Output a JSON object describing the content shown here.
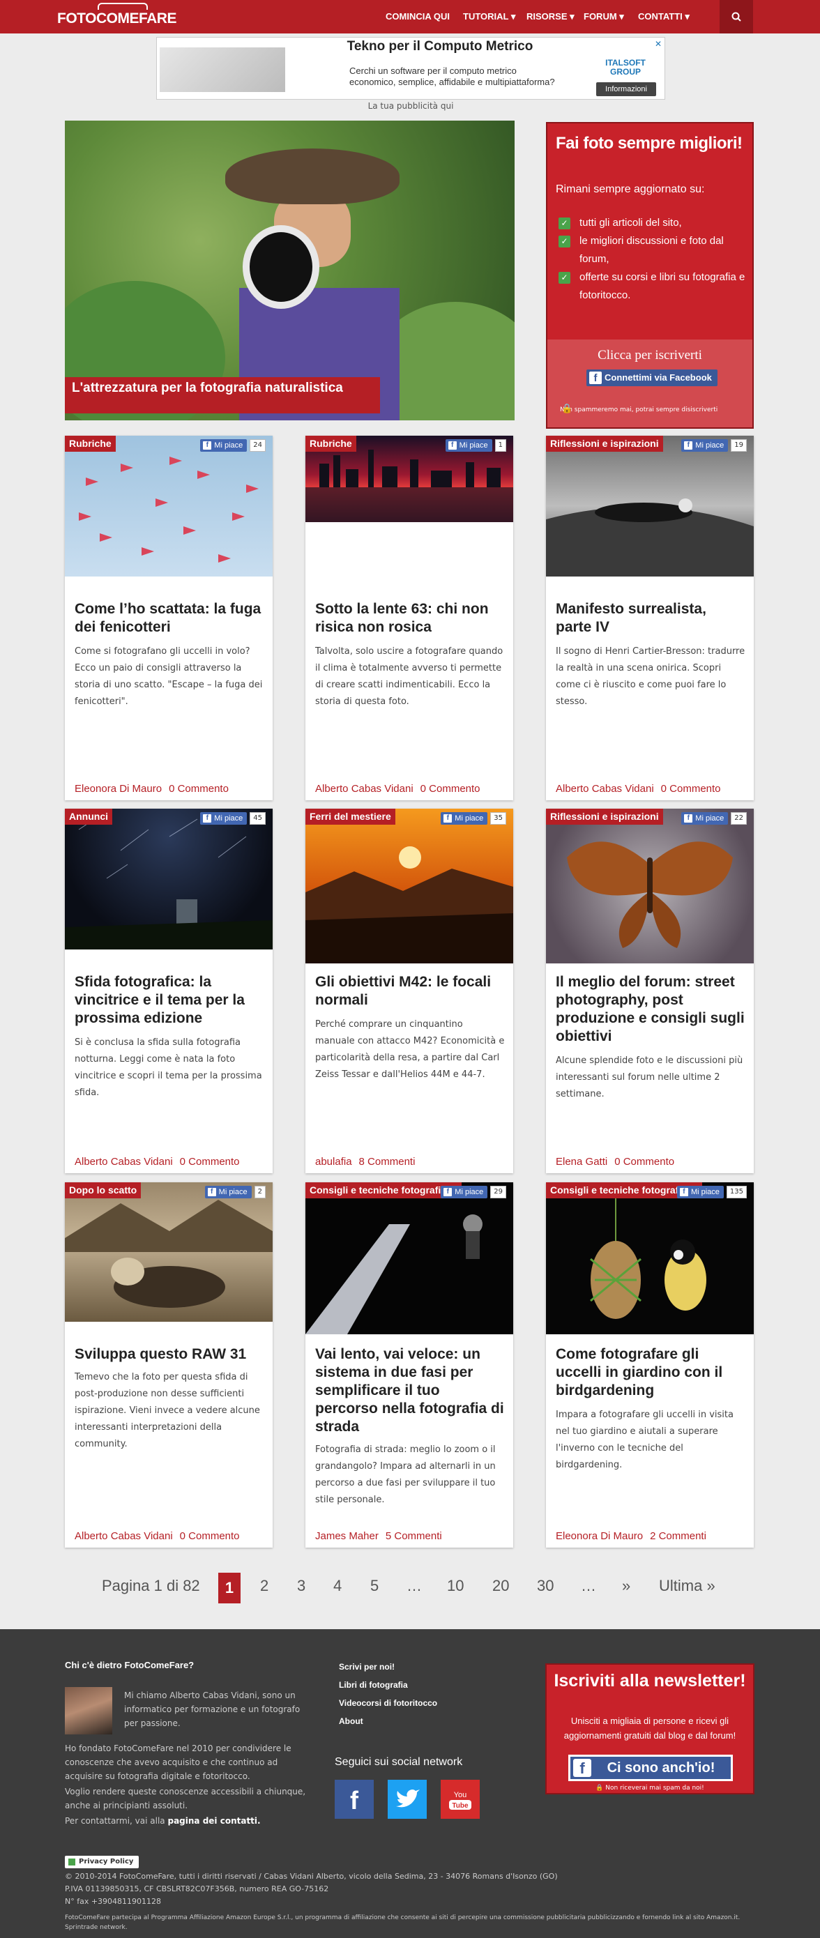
{
  "brand": {
    "logo": "FOTOCOMEFARE",
    "accent": "#b51f25"
  },
  "nav": {
    "items": [
      "COMINCIA QUI",
      "TUTORIAL ▾",
      "RISORSE ▾",
      "FORUM ▾",
      "CONTATTI ▾"
    ]
  },
  "ad": {
    "title": "Tekno per il Computo Metrico",
    "text": "Cerchi un software per il computo metrico economico, semplice, affidabile e multipiattaforma?",
    "brand": "ITALSOFT GROUP",
    "info": "Informazioni",
    "close": "✕",
    "note": "La tua pubblicità qui"
  },
  "hero": {
    "caption": "L'attrezzatura per la fotografia naturalistica"
  },
  "signup": {
    "title": "Fai foto sempre migliori!",
    "subtitle": "Rimani sempre aggiornato su:",
    "bullets": [
      "tutti gli articoli del sito,",
      "le migliori discussioni e foto dal forum,",
      "offerte su corsi e libri su fotografia e fotoritocco."
    ],
    "cta": "Clicca per iscriverti",
    "fb_button": "Connettimi via Facebook",
    "note": "Non spammeremo mai, potrai sempre disiscriverti"
  },
  "like_label": "Mi piace",
  "cards": [
    {
      "category": "Rubriche",
      "likes": "24",
      "title": "Come l’ho scattata: la fuga dei fenicotteri",
      "excerpt": "Come si fotografano gli uccelli in volo? Ecco un paio di consigli attraverso la storia di uno scatto. \"Escape – la fuga dei fenicotteri\".",
      "author": "Eleonora Di Mauro",
      "comments": "0 Commento"
    },
    {
      "category": "Rubriche",
      "likes": "1",
      "title": "Sotto la lente 63: chi non risica non rosica",
      "excerpt": "Talvolta, solo uscire a fotografare quando il clima è totalmente avverso ti permette di creare scatti indimenticabili. Ecco la storia di questa foto.",
      "author": "Alberto Cabas Vidani",
      "comments": "0 Commento"
    },
    {
      "category": "Riflessioni e ispirazioni",
      "likes": "19",
      "title": "Manifesto surrealista, parte IV",
      "excerpt": "Il sogno di Henri Cartier-Bresson: tradurre la realtà in una scena onirica. Scopri come ci è riuscito e come puoi fare lo stesso.",
      "author": "Alberto Cabas Vidani",
      "comments": "0 Commento"
    },
    {
      "category": "Annunci",
      "likes": "45",
      "title": "Sfida fotografica: la vincitrice e il tema per la prossima edizione",
      "excerpt": "Si è conclusa la sfida sulla fotografia notturna. Leggi come è nata la foto vincitrice e scopri il tema per la prossima sfida.",
      "author": "Alberto Cabas Vidani",
      "comments": "0 Commento"
    },
    {
      "category": "Ferri del mestiere",
      "likes": "35",
      "title": "Gli obiettivi M42: le focali normali",
      "excerpt": "Perché comprare un cinquantino manuale con attacco M42? Economicità e particolarità della resa, a partire dal Carl Zeiss Tessar e dall'Helios 44M e 44-7.",
      "author": "abulafia",
      "comments": "8 Commenti"
    },
    {
      "category": "Riflessioni e ispirazioni",
      "likes": "22",
      "title": "Il meglio del forum: street photography, post produzione e consigli sugli obiettivi",
      "excerpt": "Alcune splendide foto e le discussioni più interessanti sul forum nelle ultime 2 settimane.",
      "author": "Elena Gatti",
      "comments": "0 Commento"
    },
    {
      "category": "Dopo lo scatto",
      "likes": "2",
      "title": "Sviluppa questo RAW 31",
      "excerpt": "Temevo che la foto per questa sfida di post-produzione non desse sufficienti ispirazione. Vieni invece a vedere alcune interessanti interpretazioni della community.",
      "author": "Alberto Cabas Vidani",
      "comments": "0 Commento"
    },
    {
      "category": "Consigli e tecniche fotografiche",
      "likes": "29",
      "title": "Vai lento, vai veloce: un sistema in due fasi per semplificare il tuo percorso nella fotografia di strada",
      "excerpt": "Fotografia di strada: meglio lo zoom o il grandangolo? Impara ad alternarli in un percorso a due fasi per sviluppare il tuo stile personale.",
      "author": "James Maher",
      "comments": "5 Commenti"
    },
    {
      "category": "Consigli e tecniche fotografiche",
      "likes": "135",
      "title": "Come fotografare gli uccelli in giardino con il birdgardening",
      "excerpt": "Impara a fotografare gli uccelli in visita nel tuo giardino e aiutali a superare l'inverno con le tecniche del birdgardening.",
      "author": "Eleonora Di Mauro",
      "comments": "2 Commenti"
    }
  ],
  "pager": {
    "summary": "Pagina 1 di 82",
    "current": "1",
    "pages": [
      "2",
      "3",
      "4",
      "5",
      "…",
      "10",
      "20",
      "30",
      "…",
      "»",
      "Ultima »"
    ]
  },
  "footer": {
    "who_title": "Chi c'è dietro FotoComeFare?",
    "bio": "Mi chiamo Alberto Cabas Vidani, sono un informatico per formazione e un fotografo per passione.",
    "p1": "Ho fondato FotoComeFare nel 2010 per condividere le conoscenze che avevo acquisito e che continuo ad acquisire su fotografia digitale e fotoritocco.",
    "p2": "Voglio rendere queste conoscenze accessibili a chiunque, anche ai principianti assoluti.",
    "contact_prefix": "Per contattarmi, vai alla ",
    "contact_link": "pagina dei contatti.",
    "links": [
      "Scrivi per noi!",
      "Libri di fotografia",
      "Videocorsi di fotoritocco",
      "About"
    ],
    "social_title": "Seguici sui social network",
    "social": [
      {
        "name": "facebook",
        "glyph": "f",
        "color": "#3b5998"
      },
      {
        "name": "twitter",
        "glyph": "t",
        "color": "#1da1f2"
      },
      {
        "name": "youtube",
        "glyph": "You Tube",
        "color": "#d62b2b"
      }
    ],
    "news_title": "Iscriviti alla newsletter!",
    "news_text": "Unisciti a migliaia di persone e ricevi gli aggiornamenti gratuiti dal blog e dal forum!",
    "news_button": "Ci sono anch'io!",
    "news_note": "Non riceverai mai spam da noi!",
    "privacy": "Privacy Policy",
    "copy1": "© 2010-2014 FotoComeFare, tutti i diritti riservati / Cabas Vidani Alberto, vicolo della Sedima, 23 - 34076 Romans d'Isonzo (GO)",
    "copy2": "P.IVA 01139850315, CF CBSLRT82C07F356B, numero REA GO-75162",
    "copy3": "N° fax +3904811901128",
    "amazon": "FotoComeFare partecipa al Programma Affiliazione Amazon Europe S.r.l., un programma di affiliazione che consente ai siti di percepire una commissione pubblicitaria pubblicizzando e fornendo link al sito Amazon.it. Sprintrade network."
  }
}
